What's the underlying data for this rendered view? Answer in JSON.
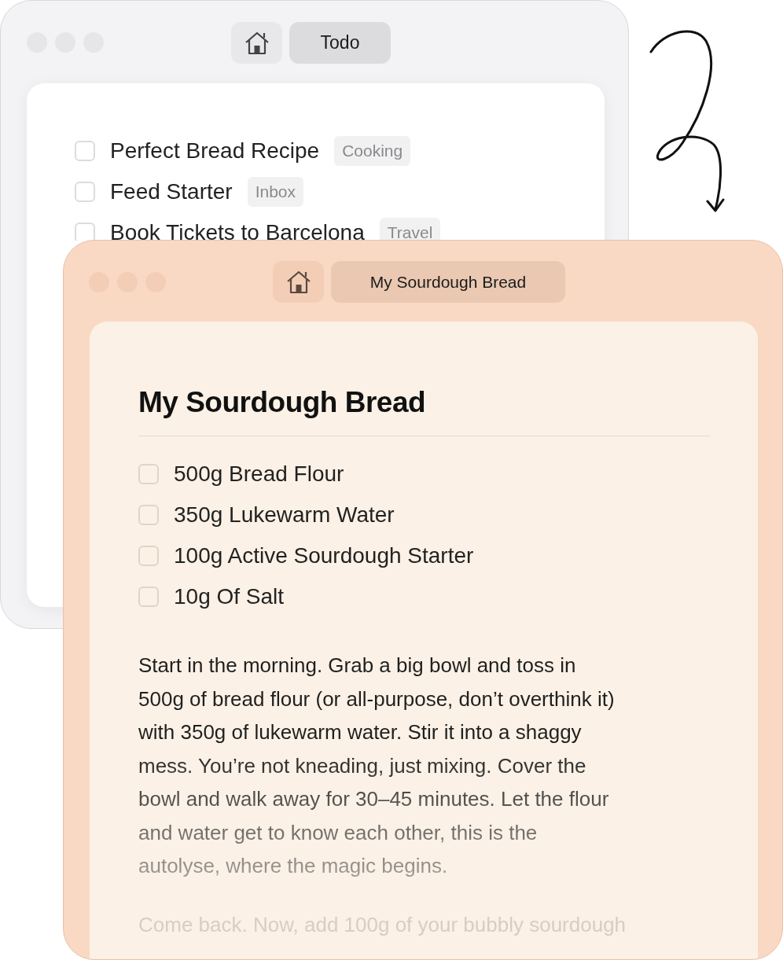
{
  "todo_window": {
    "tab": "Todo",
    "items": [
      {
        "label": "Perfect Bread Recipe",
        "tag": "Cooking",
        "checked": false
      },
      {
        "label": "Feed Starter",
        "tag": "Inbox",
        "checked": false
      },
      {
        "label": "Book Tickets to Barcelona",
        "tag": "Travel",
        "checked": false
      }
    ]
  },
  "note_window": {
    "tab": "My Sourdough Bread",
    "title": "My Sourdough Bread",
    "items": [
      {
        "label": "500g Bread Flour",
        "checked": false
      },
      {
        "label": "350g Lukewarm Water",
        "checked": false
      },
      {
        "label": "100g Active Sourdough Starter",
        "checked": false
      },
      {
        "label": "10g Of Salt",
        "checked": false
      }
    ],
    "paragraphs": [
      "Start in the morning. Grab a big bowl and toss in 500g of bread flour (or all-purpose, don’t overthink it) with 350g of lukewarm water. Stir it into a shaggy mess. You’re not kneading, just mixing. Cover the bowl and walk away for 30–45 minutes. Let the flour and water get to know each other, this is the autolyse, where the magic begins.",
      "Come back. Now, add 100g of your bubbly sourdough"
    ]
  }
}
